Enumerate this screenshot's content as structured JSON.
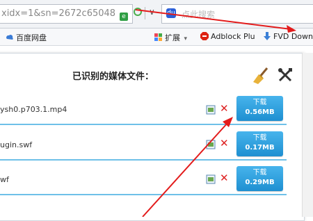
{
  "address_bar": {
    "url": "xidx=1&sn=2672c65048",
    "search_placeholder": "点此搜索"
  },
  "favorites": {
    "baidu_pan": "百度网盘",
    "extensions": "扩展",
    "adblock": "Adblock Plu",
    "fvd": "FVD Down"
  },
  "popup": {
    "title": "已识别的媒体文件：",
    "files": [
      {
        "name": "ysh0.p703.1.mp4",
        "download": "下载",
        "size": "0.56MB"
      },
      {
        "name": "ugin.swf",
        "download": "下载",
        "size": "0.17MB"
      },
      {
        "name": "wf",
        "download": "下载",
        "size": "0.29MB"
      }
    ]
  },
  "colors": {
    "accent_blue": "#2b9be0",
    "arrow_red": "#e31b1b",
    "delete_red": "#dd2222"
  }
}
